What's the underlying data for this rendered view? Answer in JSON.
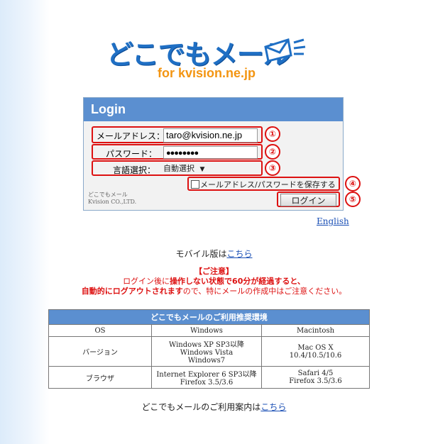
{
  "logo": {
    "title": "どこでもメール",
    "subtitle": "for kvision.ne.jp"
  },
  "login": {
    "header": "Login",
    "email_label": "メールアドレス：",
    "email_value": "taro@kvision.ne.jp",
    "password_label": "パスワード：",
    "password_value": "●●●●●●●●",
    "language_label": "言語選択：",
    "language_value": "自動選択",
    "save_label": "メールアドレス/パスワードを保存する",
    "login_button": "ログイン",
    "company_line1": "どこでもメール",
    "company_line2": "Kvision CO.,LTD.",
    "markers": [
      "①",
      "②",
      "③",
      "④",
      "⑤"
    ]
  },
  "english_link": "English",
  "mobile": {
    "text": "モバイル版は",
    "link": "こちら"
  },
  "notice": {
    "title": "【ご注意】",
    "line1_a": "ログイン後に",
    "line1_b": "操作しない状態で60分が経過すると、",
    "line2_a": "自動的にログアウトされます",
    "line2_b": "ので、特にメールの作成中はご注意ください。"
  },
  "env_table": {
    "caption": "どこでもメールのご利用推奨環境",
    "headers": [
      "OS",
      "Windows",
      "Macintosh"
    ],
    "rows": [
      {
        "label": "バージョン",
        "windows": [
          "Windows XP SP3以降",
          "Windows Vista",
          "Windows7"
        ],
        "mac": [
          "Mac OS X",
          "10.4/10.5/10.6"
        ]
      },
      {
        "label": "ブラウザ",
        "windows": [
          "Internet Explorer 6 SP3以降",
          "Firefox 3.5/3.6"
        ],
        "mac": [
          "Safari 4/5",
          "Firefox 3.5/3.6"
        ]
      }
    ]
  },
  "guide": {
    "text": "どこでもメールのご利用案内は",
    "link": "こちら"
  },
  "colors": {
    "brand_blue": "#1f6fc4",
    "accent_orange": "#f39512",
    "header_blue": "#5b8fd0",
    "alert_red": "#d11111"
  }
}
